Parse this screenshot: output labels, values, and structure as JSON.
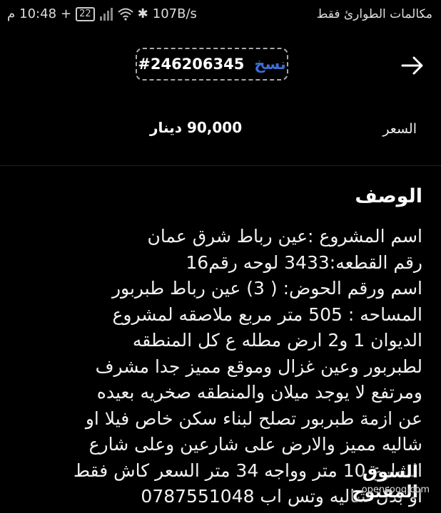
{
  "status_bar": {
    "time": "10:48",
    "am_pm": "م",
    "battery": "22",
    "network_speed": "107B/s",
    "carrier_text": "مكالمات الطوارئ فقط"
  },
  "header": {
    "copy_label": "نسخ",
    "listing_id": "#246206345"
  },
  "price": {
    "label": "السعر",
    "value": "90,000 دينار"
  },
  "description": {
    "title": "الوصف",
    "lines": [
      "اسم المشروع :عين رباط شرق عمان",
      "رقم القطعه:3433 لوحه رقم16",
      "اسم ورقم الحوض: ( 3) عين رباط طبربور",
      "المساحه : 505 متر مربع ملاصقه لمشروع",
      "الديوان 1 و2   ارض مطله ع كل المنطقه",
      "لطبربور وعين غزال وموقع مميز جدا مشرف",
      "ومرتفع لا يوجد ميلان والمنطقه صخريه بعيده",
      "عن ازمة طبربور تصلح لبناء سكن خاص فيلا او",
      "شاليه مميز والارض على شارعين وعلى شارع",
      "الشارع 10 متر وواجه 34 متر  السعر كاش فقط",
      "او بدل شاليه وتس اب 0787551048"
    ]
  },
  "watermark": {
    "arabic": "السوق المفتوح",
    "latin": "opensooq.com"
  }
}
